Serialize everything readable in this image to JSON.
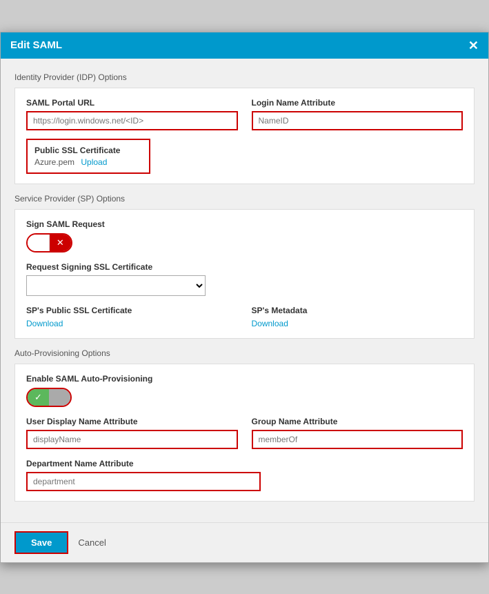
{
  "modal": {
    "title": "Edit SAML",
    "close_label": "✕"
  },
  "idp_section": {
    "label": "Identity Provider (IDP) Options",
    "saml_portal_url": {
      "label": "SAML Portal URL",
      "placeholder": "https://login.windows.net/<ID>",
      "value": ""
    },
    "login_name_attribute": {
      "label": "Login Name Attribute",
      "placeholder": "NameID",
      "value": ""
    },
    "ssl_cert": {
      "label": "Public SSL Certificate",
      "filename": "Azure.pem",
      "upload_label": "Upload"
    }
  },
  "sp_section": {
    "label": "Service Provider (SP) Options",
    "sign_saml": {
      "label": "Sign SAML Request",
      "toggle_on_icon": "✓",
      "toggle_off_icon": "✕"
    },
    "signing_ssl": {
      "label": "Request Signing SSL Certificate",
      "options": [
        ""
      ]
    },
    "sp_public_ssl": {
      "label": "SP's Public SSL Certificate",
      "link": "Download"
    },
    "sp_metadata": {
      "label": "SP's Metadata",
      "link": "Download"
    }
  },
  "auto_prov_section": {
    "label": "Auto-Provisioning Options",
    "enable_label": "Enable SAML Auto-Provisioning",
    "toggle_on_icon": "✓",
    "toggle_off_icon": "",
    "user_display_name": {
      "label": "User Display Name Attribute",
      "placeholder": "displayName",
      "value": ""
    },
    "group_name": {
      "label": "Group Name Attribute",
      "placeholder": "memberOf",
      "value": ""
    },
    "department_name": {
      "label": "Department Name Attribute",
      "placeholder": "department",
      "value": ""
    }
  },
  "footer": {
    "save_label": "Save",
    "cancel_label": "Cancel"
  }
}
